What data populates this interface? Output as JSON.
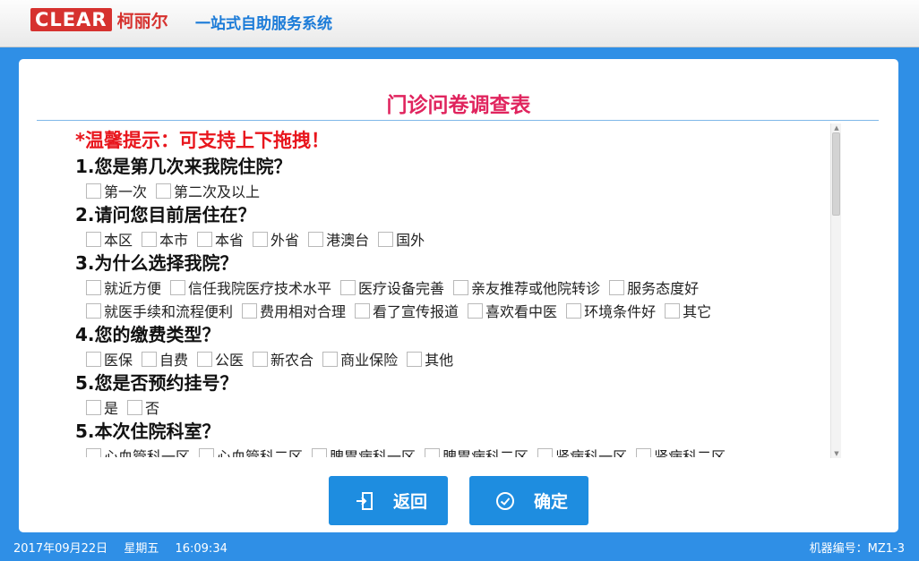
{
  "header": {
    "logo_mark": "CLEAR",
    "logo_cn": "柯丽尔",
    "system_title": "一站式自助服务系统"
  },
  "panel": {
    "title": "门诊问卷调查表",
    "tip": "*温馨提示：可支持上下拖拽！"
  },
  "questions": [
    {
      "title": "1.您是第几次来我院住院？",
      "rows": [
        [
          "第一次",
          "第二次及以上"
        ]
      ]
    },
    {
      "title": "2.请问您目前居住在？",
      "rows": [
        [
          "本区",
          "本市",
          "本省",
          "外省",
          "港澳台",
          "国外"
        ]
      ]
    },
    {
      "title": "3.为什么选择我院？",
      "rows": [
        [
          "就近方便",
          "信任我院医疗技术水平",
          "医疗设备完善",
          "亲友推荐或他院转诊",
          "服务态度好"
        ],
        [
          "就医手续和流程便利",
          "费用相对合理",
          "看了宣传报道",
          "喜欢看中医",
          "环境条件好",
          "其它"
        ]
      ]
    },
    {
      "title": "4.您的缴费类型？",
      "rows": [
        [
          "医保",
          "自费",
          "公医",
          "新农合",
          "商业保险",
          "其他"
        ]
      ]
    },
    {
      "title": "5.您是否预约挂号？",
      "rows": [
        [
          "是",
          "否"
        ]
      ]
    },
    {
      "title": "5.本次住院科室？",
      "rows": [
        [
          "心血管科一区",
          "心血管科二区",
          "脾胃病科一区",
          "脾胃病科二区",
          "肾病科一区",
          "肾病科二区"
        ]
      ]
    }
  ],
  "buttons": {
    "back_label": "返回",
    "back_icon": "exit-door-icon",
    "ok_label": "确定",
    "ok_icon": "check-circle-icon"
  },
  "footer": {
    "date": "2017年09月22日",
    "weekday": "星期五",
    "time": "16:09:34",
    "machine_id": "机器编号：MZ1-3"
  },
  "colors": {
    "background": "#2f8fe6",
    "title": "#e0245e",
    "tip": "#e8161d",
    "button": "#1e8de0",
    "brand": "#d6322f"
  }
}
